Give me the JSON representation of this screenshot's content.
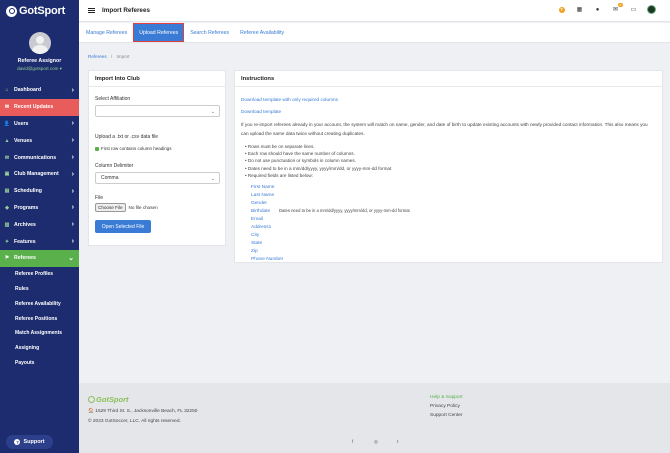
{
  "app": {
    "brand": "GotSport",
    "page_title": "Import Referees"
  },
  "user": {
    "role": "Referee Assignor",
    "email": "david@gotsport.com ▾"
  },
  "nav": [
    {
      "label": "Dashboard",
      "icon": "dashboard-icon",
      "glyph": "⌂"
    },
    {
      "label": "Recent Updates",
      "icon": "recent-updates-icon",
      "glyph": "✉"
    },
    {
      "label": "Users",
      "icon": "users-icon",
      "glyph": "👤"
    },
    {
      "label": "Venues",
      "icon": "venues-icon",
      "glyph": "▲"
    },
    {
      "label": "Communications",
      "icon": "communications-icon",
      "glyph": "✉"
    },
    {
      "label": "Club Management",
      "icon": "club-icon",
      "glyph": "▣"
    },
    {
      "label": "Scheduling",
      "icon": "calendar-icon",
      "glyph": "▤"
    },
    {
      "label": "Programs",
      "icon": "programs-icon",
      "glyph": "◆"
    },
    {
      "label": "Archives",
      "icon": "archives-icon",
      "glyph": "▥"
    },
    {
      "label": "Features",
      "icon": "features-icon",
      "glyph": "✦"
    },
    {
      "label": "Referees",
      "icon": "referees-icon",
      "glyph": "⚑"
    }
  ],
  "sub_nav": [
    "Referee Profiles",
    "Rules",
    "Referee Availability",
    "Referee Positions",
    "Match Assignments",
    "Assigning",
    "Payouts"
  ],
  "support_label": "Support",
  "tabs": [
    "Manage Referees",
    "Upload Referees",
    "Search Referees",
    "Referee Availability"
  ],
  "breadcrumb": {
    "parent": "Referees",
    "sep": "/",
    "current": "Import"
  },
  "import_card": {
    "title": "Import Into Club",
    "affiliation_label": "Select Affiliation",
    "affiliation_value": "",
    "upload_label": "Upload a .txt or .csv data file",
    "header_checkbox": "First row contains column headings",
    "delimiter_label": "Column Delimiter",
    "delimiter_value": "Comma",
    "file_label": "File",
    "choose_file": "Choose File",
    "no_file": "No file chosen",
    "open_button": "Open Selected File"
  },
  "instructions": {
    "title": "Instructions",
    "link_required": "Download template with only required columns",
    "link_template": "Download template",
    "paragraph": "If you re-import referees already in your account, the system will match on name, gender, and date of birth to update existing accounts with newly provided contact information. This also means you can upload the same data twice without creating duplicates.",
    "rules": [
      "• Rows must be on separate lines.",
      "• Each row should have the same number of columns.",
      "• Do not use punctuation or symbols in column names.",
      "• Dates need to be in a mm/dd/yyyy, yyyy/mm/dd, or yyyy-mm-dd format",
      "• Required fields are listed below:"
    ],
    "fields": [
      "First Name",
      "Last Name",
      "Gender",
      "Birthdate",
      "Email",
      "Address1",
      "City",
      "State",
      "Zip",
      "Phone Number"
    ],
    "birthdate_note": "Dates need to be in a mm/dd/yyyy, yyyy/mm/dd, or yyyy-mm-dd format"
  },
  "footer": {
    "brand": "GotSport",
    "address": "🏠 1529 Third St. S., Jacksonville Beach, FL 32250",
    "copyright": "© 2023 GotSoccer, LLC. All rights reserved.",
    "links": [
      "Help & Support",
      "Privacy Policy",
      "Support Center"
    ],
    "social": [
      "f",
      "◎",
      "t"
    ]
  },
  "colors": {
    "sidebar": "#1c2c6e",
    "accent": "#3a7bd5",
    "active_nav": "#5ab14b",
    "recent": "#e95c5c"
  }
}
